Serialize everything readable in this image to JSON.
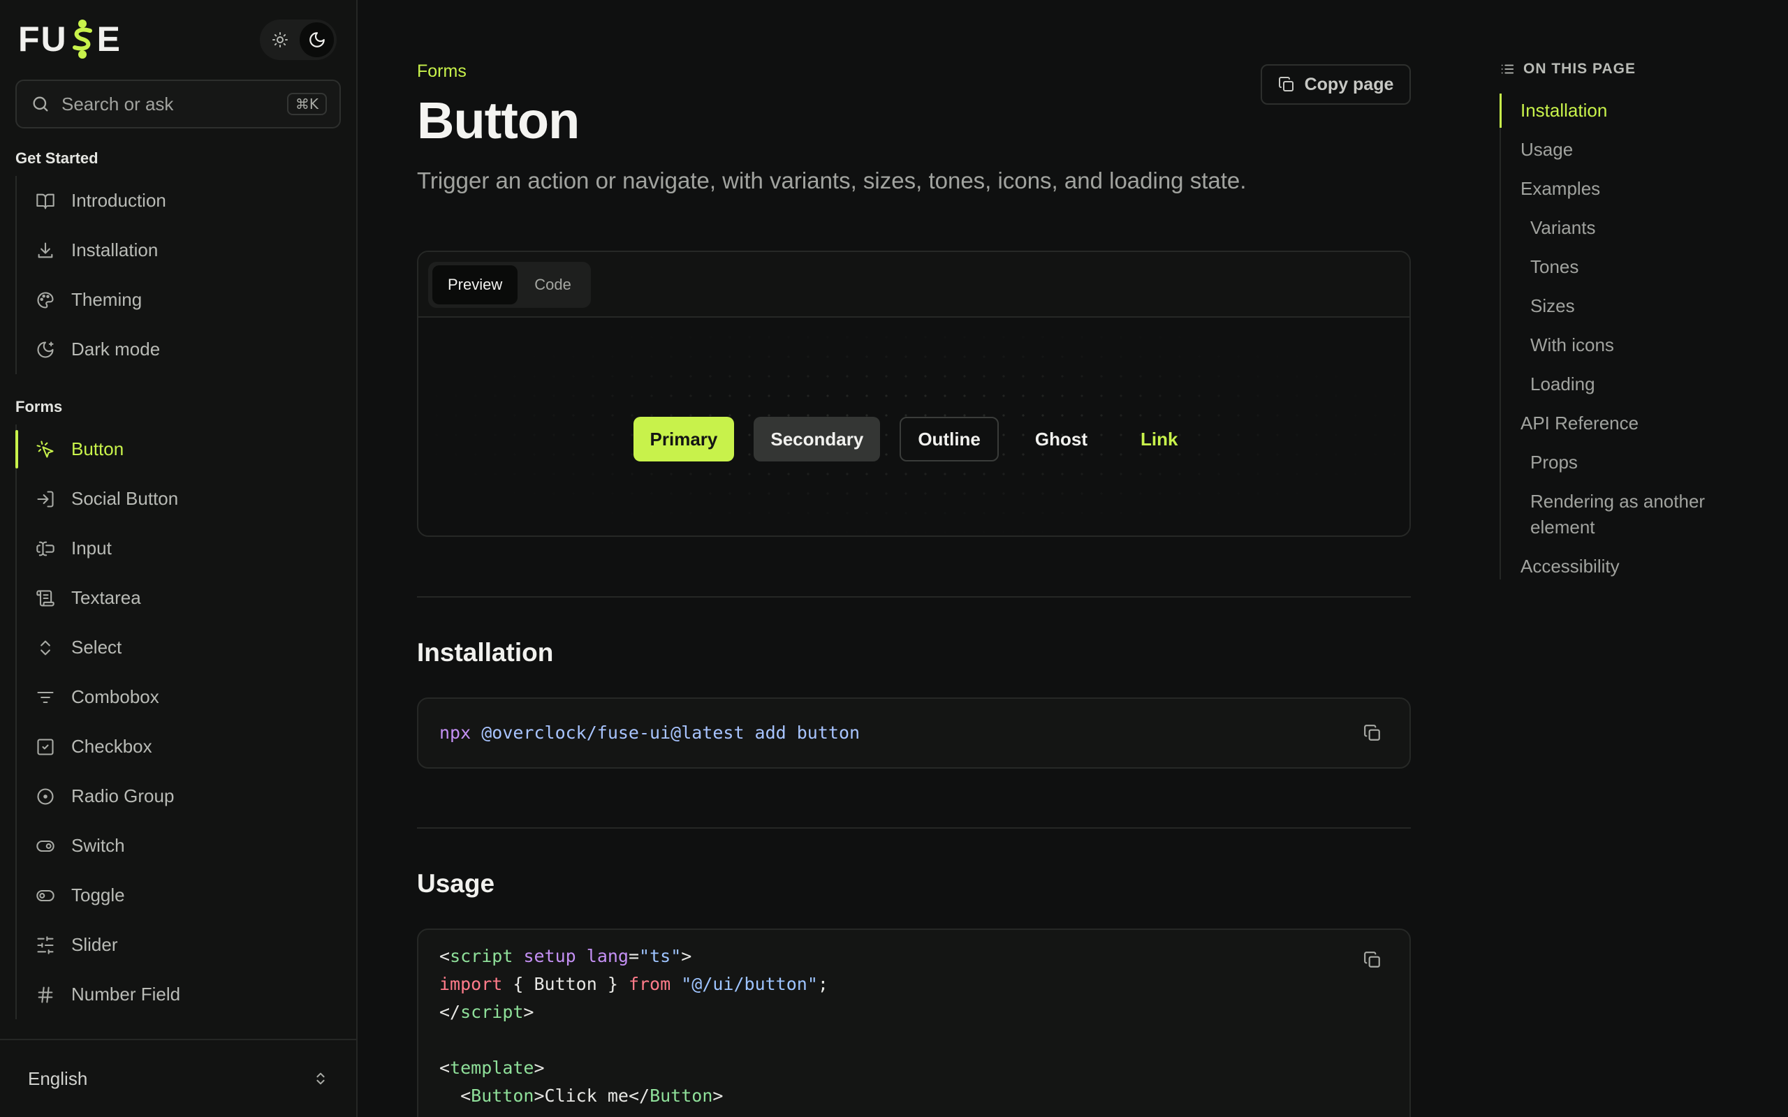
{
  "brand": {
    "name_left": "FU",
    "name_right": "E",
    "accent": "#c8f24b"
  },
  "theme_toggle": {
    "light_icon": "sun-icon",
    "dark_icon": "moon-icon",
    "active": "dark"
  },
  "search": {
    "placeholder": "Search or ask",
    "shortcut": "⌘K"
  },
  "sidebar": {
    "sections": [
      {
        "heading": "Get Started",
        "items": [
          {
            "label": "Introduction",
            "icon": "book-icon"
          },
          {
            "label": "Installation",
            "icon": "download-icon"
          },
          {
            "label": "Theming",
            "icon": "palette-icon"
          },
          {
            "label": "Dark mode",
            "icon": "moon-star-icon"
          }
        ]
      },
      {
        "heading": "Forms",
        "items": [
          {
            "label": "Button",
            "icon": "pointer-click-icon",
            "active": true
          },
          {
            "label": "Social Button",
            "icon": "log-in-icon"
          },
          {
            "label": "Input",
            "icon": "text-cursor-input-icon"
          },
          {
            "label": "Textarea",
            "icon": "scroll-text-icon"
          },
          {
            "label": "Select",
            "icon": "chevrons-up-down-icon"
          },
          {
            "label": "Combobox",
            "icon": "list-filter-icon"
          },
          {
            "label": "Checkbox",
            "icon": "square-check-icon"
          },
          {
            "label": "Radio Group",
            "icon": "circle-dot-icon"
          },
          {
            "label": "Switch",
            "icon": "toggle-right-icon"
          },
          {
            "label": "Toggle",
            "icon": "toggle-left-icon"
          },
          {
            "label": "Slider",
            "icon": "sliders-horizontal-icon"
          },
          {
            "label": "Number Field",
            "icon": "hash-icon"
          }
        ]
      }
    ],
    "footer": {
      "language": "English"
    }
  },
  "page": {
    "breadcrumb": "Forms",
    "copy_label": "Copy page",
    "title": "Button",
    "description": "Trigger an action or navigate, with variants, sizes, tones, icons, and loading state.",
    "tabs": [
      "Preview",
      "Code"
    ],
    "active_tab": "Preview",
    "demo_buttons": [
      "Primary",
      "Secondary",
      "Outline",
      "Ghost",
      "Link"
    ],
    "installation_heading": "Installation",
    "install_command": {
      "cmd": "npx",
      "args": "@overclock/fuse-ui@latest add button"
    },
    "usage_heading": "Usage",
    "usage_code": {
      "l1_tag": "script",
      "l1_attr1": "setup",
      "l1_attr2": "lang",
      "l1_val": "\"ts\"",
      "l2_kw": "import",
      "l2_mid": " { Button } ",
      "l2_from": "from",
      "l2_str": "\"@/ui/button\"",
      "l3_tag": "script",
      "l5_tag": "template",
      "l6_comp": "Button",
      "l6_text": "Click me"
    }
  },
  "toc": {
    "heading": "ON THIS PAGE",
    "items": [
      {
        "label": "Installation",
        "level": 1,
        "active": true
      },
      {
        "label": "Usage",
        "level": 1
      },
      {
        "label": "Examples",
        "level": 1
      },
      {
        "label": "Variants",
        "level": 2
      },
      {
        "label": "Tones",
        "level": 2
      },
      {
        "label": "Sizes",
        "level": 2
      },
      {
        "label": "With icons",
        "level": 2
      },
      {
        "label": "Loading",
        "level": 2
      },
      {
        "label": "API Reference",
        "level": 1
      },
      {
        "label": "Props",
        "level": 2
      },
      {
        "label": "Rendering as another element",
        "level": 2
      },
      {
        "label": "Accessibility",
        "level": 1
      }
    ]
  }
}
